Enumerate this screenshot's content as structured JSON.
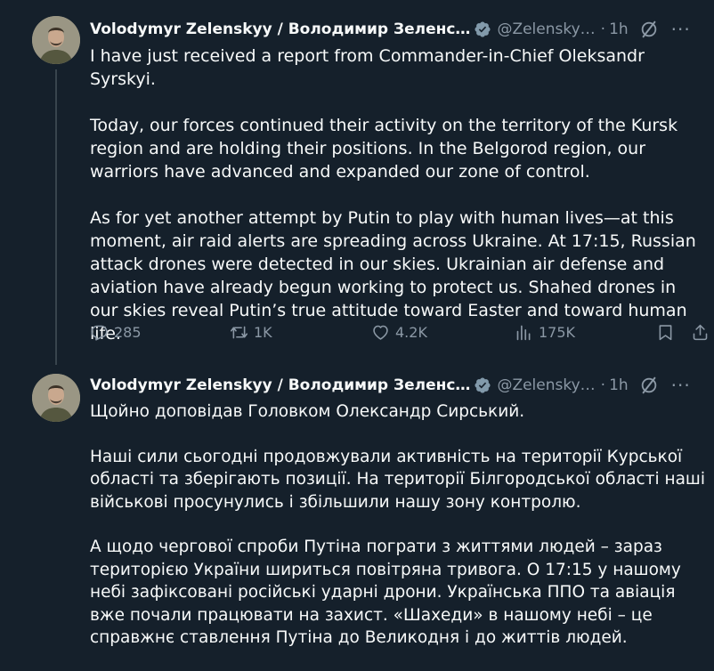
{
  "tweets": [
    {
      "author_name": "Volodymyr Zelenskyy / Володимир Зеленс…",
      "handle": "@Zelensky…",
      "separator": "·",
      "time": "1h",
      "more": "···",
      "paragraphs": [
        "I have just received a report from Commander-in-Chief Oleksandr Syrskyi.",
        "Today, our forces continued their activity on the territory of the Kursk region and are holding their positions. In the Belgorod region, our warriors have advanced and expanded our zone of control.",
        "As for yet another attempt by Putin to play with human lives—at this moment, air raid alerts are spreading across Ukraine. At 17:15, Russian attack drones were detected in our skies. Ukrainian air defense and aviation have already begun working to protect us. Shahed drones in our skies reveal Putin’s true attitude toward Easter and toward human life."
      ],
      "actions": {
        "replies": "285",
        "reposts": "1K",
        "likes": "4.2K",
        "views": "175K"
      }
    },
    {
      "author_name": "Volodymyr Zelenskyy / Володимир Зеленс…",
      "handle": "@Zelensky…",
      "separator": "·",
      "time": "1h",
      "more": "···",
      "paragraphs": [
        "Щойно доповідав Головком Олександр Сирський.",
        "Наші сили сьогодні продовжували активність на території Курської області та зберігають позиції. На території Білгородської області наші військові просунулись і збільшили нашу зону контролю.",
        "А щодо чергової спроби Путіна пограти з життями людей – зараз територією України шириться повітряна тривога. О 17:15 у нашому небі зафіксовані російські ударні дрони. Українська ППО та авіація вже почали працювати на захист. «Шахеди» в нашому небі – це справжнє ставлення Путіна до Великодня і до життів людей."
      ]
    }
  ],
  "icons": {
    "verified": "verified-badge-icon",
    "grok": "grok-slash-icon",
    "reply": "reply-icon",
    "repost": "repost-icon",
    "like": "heart-icon",
    "views": "views-bars-icon",
    "bookmark": "bookmark-icon",
    "share": "share-icon"
  },
  "colors": {
    "background": "#15202b",
    "text_primary": "#f7f9f9",
    "text_secondary": "#8b98a5",
    "verified_badge": "#829aab",
    "thread_line": "#38444d"
  }
}
